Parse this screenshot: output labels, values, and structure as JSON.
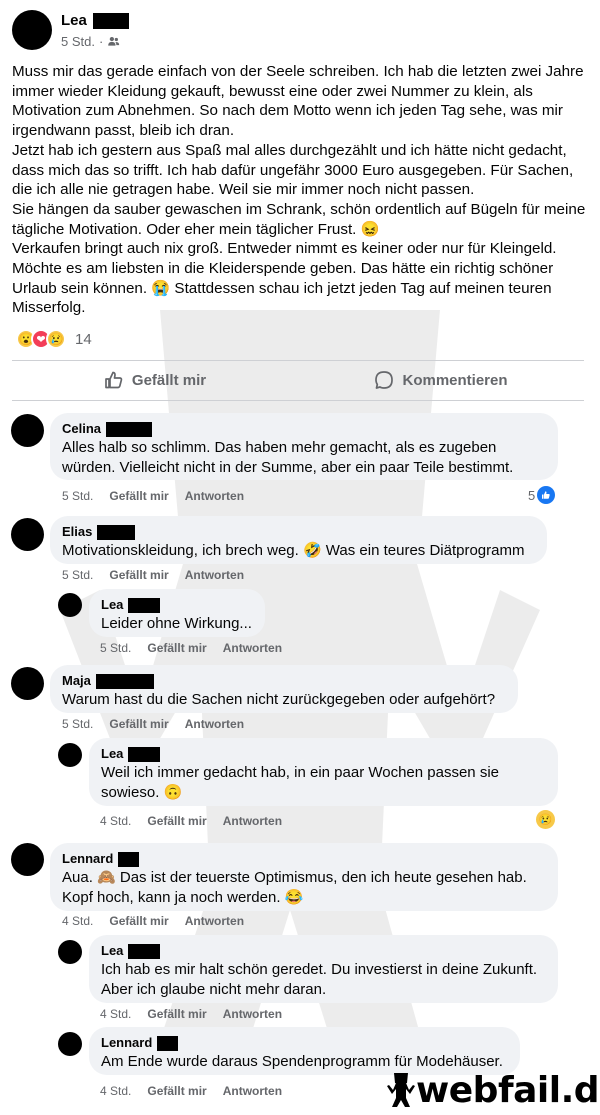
{
  "post": {
    "author": "Lea",
    "time": "5 Std.",
    "separator": "·",
    "audience_icon": "friends-icon",
    "paragraphs": [
      "Muss mir das gerade einfach von der Seele schreiben. Ich hab die letzten zwei Jahre immer wieder Kleidung gekauft, bewusst eine oder zwei Nummer zu klein, als Motivation zum Abnehmen. So nach dem Motto wenn ich jeden Tag sehe, was mir irgendwann passt, bleib ich dran.",
      "Jetzt hab ich gestern aus Spaß mal alles durchgezählt und ich hätte nicht gedacht, dass mich das so trifft. Ich hab dafür ungefähr 3000 Euro ausgegeben. Für Sachen, die ich alle nie getragen habe. Weil sie mir immer noch nicht passen.",
      "Sie hängen da sauber gewaschen im Schrank, schön ordentlich auf Bügeln für meine tägliche Motivation. Oder eher mein täglicher Frust. 😖",
      "Verkaufen bringt auch nix groß. Entweder nimmt es keiner oder nur für Kleingeld. Möchte es am liebsten in die Kleiderspende geben. Das hätte ein richtig schöner Urlaub sein können. 😭 Stattdessen schau ich jetzt jeden Tag auf meinen teuren Misserfolg."
    ],
    "reactions": [
      "😮",
      "❤",
      "😢"
    ],
    "reaction_count": "14",
    "like_label": "Gefällt mir",
    "comment_label": "Kommentieren"
  },
  "comments": [
    {
      "name": "Celina",
      "text": "Alles halb so schlimm. Das haben mehr gemacht, als es zugeben würden. Vielleicht nicht in der Summe, aber ein paar Teile bestimmt.",
      "time": "5 Std.",
      "like": "Gefällt mir",
      "reply": "Antworten",
      "badge_count": "5"
    },
    {
      "name": "Elias",
      "text": "Motivationskleidung, ich brech weg. 🤣 Was ein teures Diätprogramm",
      "time": "5 Std.",
      "like": "Gefällt mir",
      "reply": "Antworten"
    },
    {
      "name": "Lea",
      "text": "Leider ohne Wirkung...",
      "time": "5 Std.",
      "like": "Gefällt mir",
      "reply": "Antworten"
    },
    {
      "name": "Maja",
      "text": "Warum hast du die Sachen nicht zurückgegeben oder aufgehört?",
      "time": "5 Std.",
      "like": "Gefällt mir",
      "reply": "Antworten"
    },
    {
      "name": "Lea",
      "text": "Weil ich immer gedacht hab, in ein paar Wochen passen sie sowieso. 🙃",
      "time": "4 Std.",
      "like": "Gefällt mir",
      "reply": "Antworten",
      "badge_emoji": "😢"
    },
    {
      "name": "Lennard",
      "text": "Aua. 🙈 Das ist der teuerste Optimismus, den ich heute gesehen hab. Kopf hoch, kann ja noch werden. 😂",
      "time": "4 Std.",
      "like": "Gefällt mir",
      "reply": "Antworten"
    },
    {
      "name": "Lea",
      "text": "Ich hab es mir halt schön geredet. Du investierst in deine Zukunft. Aber ich glaube nicht mehr daran.",
      "time": "4 Std.",
      "like": "Gefällt mir",
      "reply": "Antworten"
    },
    {
      "name": "Lennard",
      "text": "Am Ende wurde daraus Spendenprogramm für Modehäuser.",
      "time": "4 Std.",
      "like": "Gefällt mir",
      "reply": "Antworten"
    }
  ],
  "watermark": {
    "text": "webfail.de"
  },
  "colors": {
    "secondary": "#65676b",
    "bubble": "#f0f2f5",
    "like_blue": "#1877f2"
  }
}
